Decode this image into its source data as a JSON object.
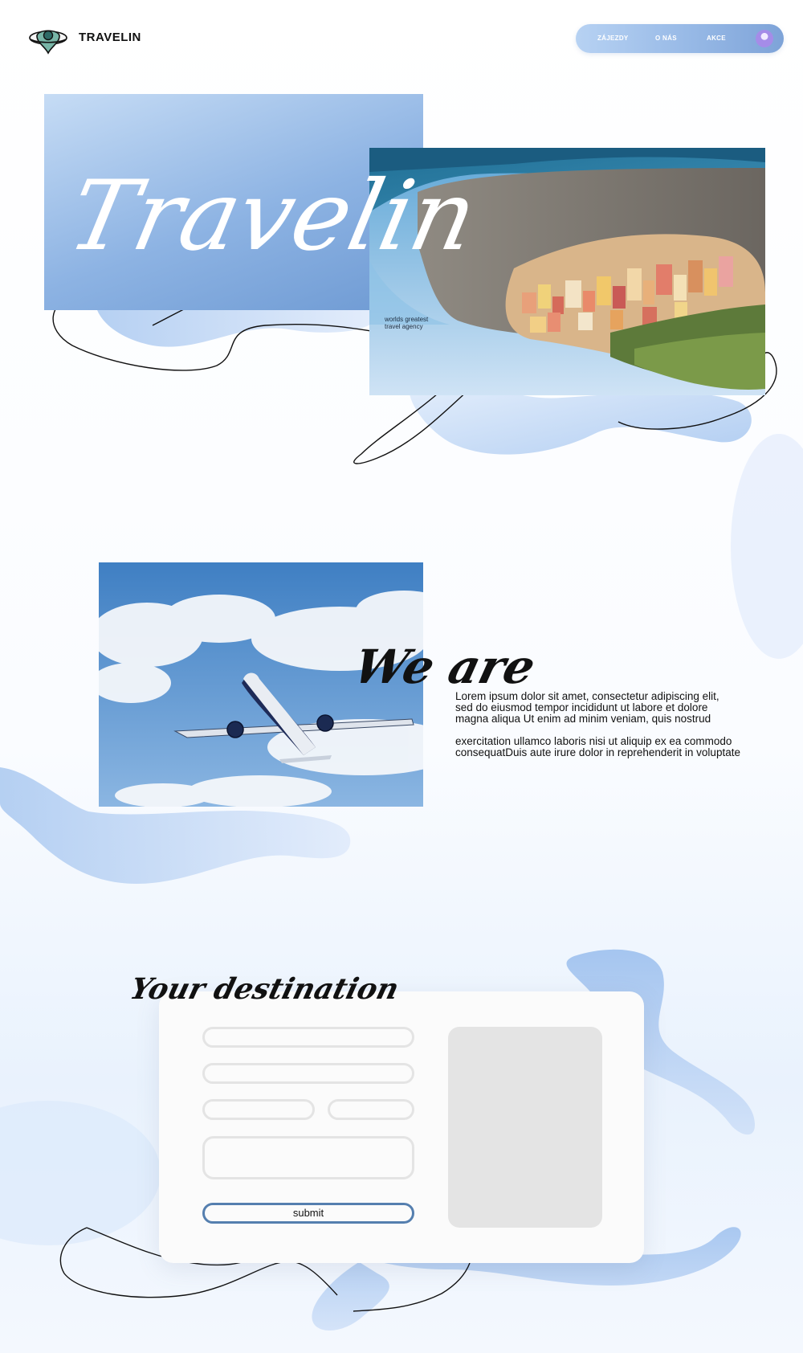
{
  "header": {
    "brand": "TRAVELIN",
    "nav_items": [
      "ZÁJEZDY",
      "O NÁS",
      "AKCE"
    ]
  },
  "hero": {
    "title": "Travelin",
    "tagline_line1": "worlds greatest",
    "tagline_line2": "travel agency"
  },
  "about": {
    "heading": "We are",
    "paragraph1_line1": "Lorem ipsum dolor sit amet, consectetur adipiscing elit,",
    "paragraph1_line2": "sed do eiusmod tempor incididunt ut labore et dolore",
    "paragraph1_line3": "magna aliqua Ut enim ad minim veniam, quis nostrud",
    "paragraph2_line1": "exercitation ullamco laboris nisi ut aliquip ex ea commodo",
    "paragraph2_line2": "consequatDuis aute irure dolor in reprehenderit in voluptate"
  },
  "destination": {
    "heading": "Your destination",
    "submit_label": "submit"
  },
  "colors": {
    "accent": "#8db3e3",
    "nav_gradient_start": "#b7d2f3",
    "nav_gradient_end": "#7ea3d8",
    "submit_border": "#557faf",
    "field_border": "#e4e4e4"
  },
  "icons": {
    "logo": "globe-planet-icon",
    "avatar": "user-avatar-icon"
  }
}
